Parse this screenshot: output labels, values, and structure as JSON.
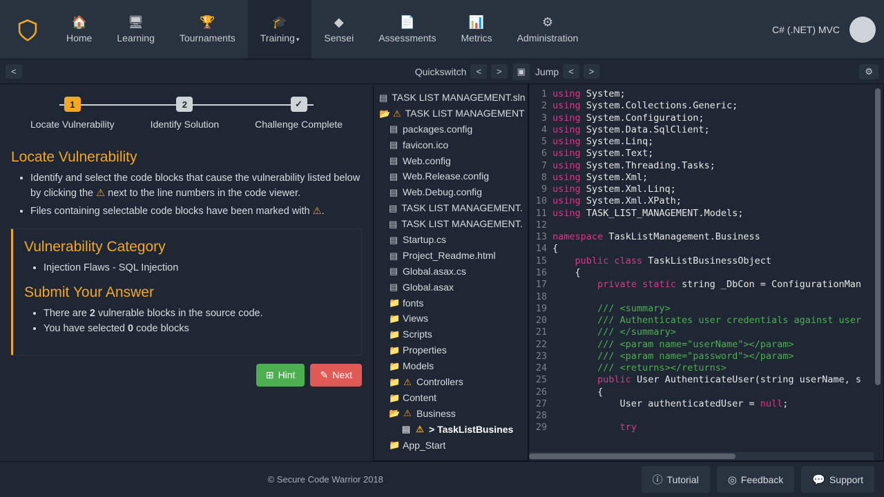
{
  "header": {
    "context": "C# (.NET) MVC",
    "nav": [
      {
        "icon": "🏠",
        "label": "Home"
      },
      {
        "icon": "🖥",
        "label": "Learning"
      },
      {
        "icon": "🏆",
        "label": "Tournaments"
      },
      {
        "icon": "🎓",
        "label": "Training",
        "active": true,
        "dropdown": true
      },
      {
        "icon": "◆",
        "label": "Sensei"
      },
      {
        "icon": "📄",
        "label": "Assessments"
      },
      {
        "icon": "📊",
        "label": "Metrics"
      },
      {
        "icon": "⚙",
        "label": "Administration"
      }
    ]
  },
  "secbar": {
    "back": "<",
    "quickswitch": "Quickswitch",
    "prev": "<",
    "next": ">",
    "jump": "Jump",
    "gear": "⚙"
  },
  "stepper": {
    "steps": [
      {
        "num": "1",
        "label": "Locate Vulnerability",
        "kind": "active"
      },
      {
        "num": "2",
        "label": "Identify Solution",
        "kind": "inactive"
      },
      {
        "num": "✓",
        "label": "Challenge Complete",
        "kind": "check"
      }
    ]
  },
  "instructions": {
    "title": "Locate Vulnerability",
    "bullets": [
      "Identify and select the code blocks that cause the vulnerability listed below by clicking the ⚠ next to the line numbers in the code viewer.",
      "Files containing selectable code blocks have been marked with ⚠."
    ]
  },
  "card": {
    "cat_title": "Vulnerability Category",
    "cat_item": "Injection Flaws - SQL Injection",
    "ans_title": "Submit Your Answer",
    "ans1_a": "There are ",
    "ans1_b": "2",
    "ans1_c": " vulnerable blocks in the source code.",
    "ans2_a": "You have selected ",
    "ans2_b": "0",
    "ans2_c": " code blocks"
  },
  "buttons": {
    "hint": "Hint",
    "next": "Next",
    "tutorial": "Tutorial",
    "feedback": "Feedback",
    "support": "Support"
  },
  "filetree": [
    {
      "depth": 0,
      "icon": "file",
      "label": "TASK LIST MANAGEMENT.sln"
    },
    {
      "depth": 0,
      "icon": "folderopen",
      "warn": true,
      "label": "TASK LIST MANAGEMENT"
    },
    {
      "depth": 1,
      "icon": "file",
      "label": "packages.config"
    },
    {
      "depth": 1,
      "icon": "file",
      "label": "favicon.ico"
    },
    {
      "depth": 1,
      "icon": "file",
      "label": "Web.config"
    },
    {
      "depth": 1,
      "icon": "file",
      "label": "Web.Release.config"
    },
    {
      "depth": 1,
      "icon": "file",
      "label": "Web.Debug.config"
    },
    {
      "depth": 1,
      "icon": "file",
      "label": "TASK LIST MANAGEMENT."
    },
    {
      "depth": 1,
      "icon": "file",
      "label": "TASK LIST MANAGEMENT."
    },
    {
      "depth": 1,
      "icon": "file",
      "label": "Startup.cs"
    },
    {
      "depth": 1,
      "icon": "file",
      "label": "Project_Readme.html"
    },
    {
      "depth": 1,
      "icon": "file",
      "label": "Global.asax.cs"
    },
    {
      "depth": 1,
      "icon": "file",
      "label": "Global.asax"
    },
    {
      "depth": 1,
      "icon": "folder",
      "label": "fonts"
    },
    {
      "depth": 1,
      "icon": "folder",
      "label": "Views"
    },
    {
      "depth": 1,
      "icon": "folder",
      "label": "Scripts"
    },
    {
      "depth": 1,
      "icon": "folder",
      "label": "Properties"
    },
    {
      "depth": 1,
      "icon": "folder",
      "label": "Models"
    },
    {
      "depth": 1,
      "icon": "folder",
      "warn": true,
      "label": "Controllers"
    },
    {
      "depth": 1,
      "icon": "folder",
      "label": "Content"
    },
    {
      "depth": 1,
      "icon": "folderopen",
      "warn": true,
      "label": "Business"
    },
    {
      "depth": 2,
      "icon": "file",
      "warn": true,
      "label": "> TaskListBusines",
      "selected": true
    },
    {
      "depth": 1,
      "icon": "folder",
      "label": "App_Start"
    }
  ],
  "code": [
    {
      "n": 1,
      "seg": [
        [
          "kw",
          "using"
        ],
        [
          "id",
          " System;"
        ]
      ]
    },
    {
      "n": 2,
      "seg": [
        [
          "kw",
          "using"
        ],
        [
          "id",
          " System.Collections.Generic;"
        ]
      ]
    },
    {
      "n": 3,
      "seg": [
        [
          "kw",
          "using"
        ],
        [
          "id",
          " System.Configuration;"
        ]
      ]
    },
    {
      "n": 4,
      "seg": [
        [
          "kw",
          "using"
        ],
        [
          "id",
          " System.Data.SqlClient;"
        ]
      ]
    },
    {
      "n": 5,
      "seg": [
        [
          "kw",
          "using"
        ],
        [
          "id",
          " System.Linq;"
        ]
      ]
    },
    {
      "n": 6,
      "seg": [
        [
          "kw",
          "using"
        ],
        [
          "id",
          " System.Text;"
        ]
      ]
    },
    {
      "n": 7,
      "seg": [
        [
          "kw",
          "using"
        ],
        [
          "id",
          " System.Threading.Tasks;"
        ]
      ]
    },
    {
      "n": 8,
      "seg": [
        [
          "kw",
          "using"
        ],
        [
          "id",
          " System.Xml;"
        ]
      ]
    },
    {
      "n": 9,
      "seg": [
        [
          "kw",
          "using"
        ],
        [
          "id",
          " System.Xml.Linq;"
        ]
      ]
    },
    {
      "n": 10,
      "seg": [
        [
          "kw",
          "using"
        ],
        [
          "id",
          " System.Xml.XPath;"
        ]
      ]
    },
    {
      "n": 11,
      "seg": [
        [
          "kw",
          "using"
        ],
        [
          "id",
          " TASK_LIST_MANAGEMENT.Models;"
        ]
      ]
    },
    {
      "n": 12,
      "seg": [
        [
          "id",
          ""
        ]
      ]
    },
    {
      "n": 13,
      "seg": [
        [
          "kw",
          "namespace"
        ],
        [
          "id",
          " TaskListManagement.Business"
        ]
      ]
    },
    {
      "n": 14,
      "seg": [
        [
          "id",
          "{"
        ]
      ]
    },
    {
      "n": 15,
      "seg": [
        [
          "id",
          "    "
        ],
        [
          "kw",
          "public class"
        ],
        [
          "id",
          " TaskListBusinessObject"
        ]
      ]
    },
    {
      "n": 16,
      "seg": [
        [
          "id",
          "    {"
        ]
      ]
    },
    {
      "n": 17,
      "seg": [
        [
          "id",
          "        "
        ],
        [
          "kw",
          "private static"
        ],
        [
          "id",
          " string _DbCon = ConfigurationMan"
        ]
      ]
    },
    {
      "n": 18,
      "seg": [
        [
          "id",
          ""
        ]
      ]
    },
    {
      "n": 19,
      "seg": [
        [
          "id",
          "        "
        ],
        [
          "cm",
          "/// <summary>"
        ]
      ]
    },
    {
      "n": 20,
      "seg": [
        [
          "id",
          "        "
        ],
        [
          "cm",
          "/// Authenticates user credentials against user"
        ]
      ]
    },
    {
      "n": 21,
      "seg": [
        [
          "id",
          "        "
        ],
        [
          "cm",
          "/// </summary>"
        ]
      ]
    },
    {
      "n": 22,
      "seg": [
        [
          "id",
          "        "
        ],
        [
          "cm",
          "/// <param name=\"userName\"></param>"
        ]
      ]
    },
    {
      "n": 23,
      "seg": [
        [
          "id",
          "        "
        ],
        [
          "cm",
          "/// <param name=\"password\"></param>"
        ]
      ]
    },
    {
      "n": 24,
      "seg": [
        [
          "id",
          "        "
        ],
        [
          "cm",
          "/// <returns></returns>"
        ]
      ]
    },
    {
      "n": 25,
      "seg": [
        [
          "id",
          "        "
        ],
        [
          "kw",
          "public"
        ],
        [
          "id",
          " User AuthenticateUser(string userName, s"
        ]
      ]
    },
    {
      "n": 26,
      "seg": [
        [
          "id",
          "        {"
        ]
      ]
    },
    {
      "n": 27,
      "seg": [
        [
          "id",
          "            User authenticatedUser = "
        ],
        [
          "kw",
          "null"
        ],
        [
          "id",
          ";"
        ]
      ]
    },
    {
      "n": 28,
      "seg": [
        [
          "id",
          ""
        ]
      ]
    },
    {
      "n": 29,
      "seg": [
        [
          "id",
          "            "
        ],
        [
          "kw",
          "try"
        ]
      ]
    }
  ],
  "footer": {
    "copy": "© Secure Code Warrior 2018"
  }
}
